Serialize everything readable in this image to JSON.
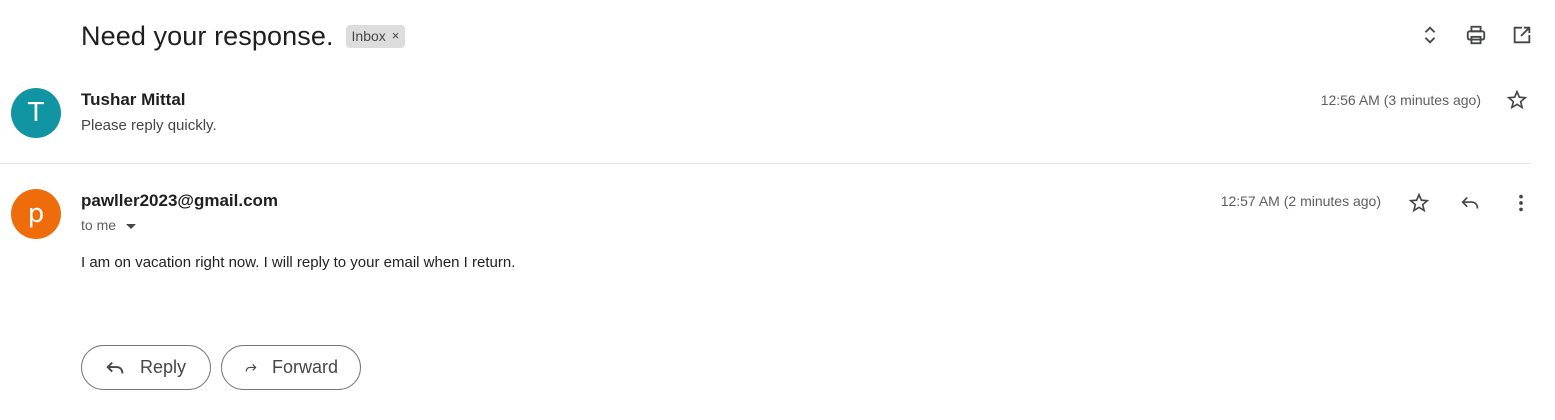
{
  "thread": {
    "subject": "Need your response.",
    "label_chip": {
      "text": "Inbox",
      "remove_glyph": "×"
    },
    "top_actions": [
      {
        "name": "expand-collapse-icon",
        "icon": "unfold"
      },
      {
        "name": "print-icon",
        "icon": "printer"
      },
      {
        "name": "open-in-new-window-icon",
        "icon": "open-external"
      }
    ]
  },
  "messages": [
    {
      "avatar_letter": "T",
      "avatar_color": "#1295a3",
      "sender": "Tushar Mittal",
      "snippet": "Please reply quickly.",
      "time": "12:56 AM (3 minutes ago)",
      "starred": false
    },
    {
      "avatar_letter": "p",
      "avatar_color": "#ee6d0a",
      "sender": "pawller2023@gmail.com",
      "recipient_line": "to me",
      "time": "12:57 AM (2 minutes ago)",
      "body": "I am on vacation right now. I will reply to your email when I return.",
      "starred": false
    }
  ],
  "reply_actions": {
    "reply_label": "Reply",
    "forward_label": "Forward"
  }
}
